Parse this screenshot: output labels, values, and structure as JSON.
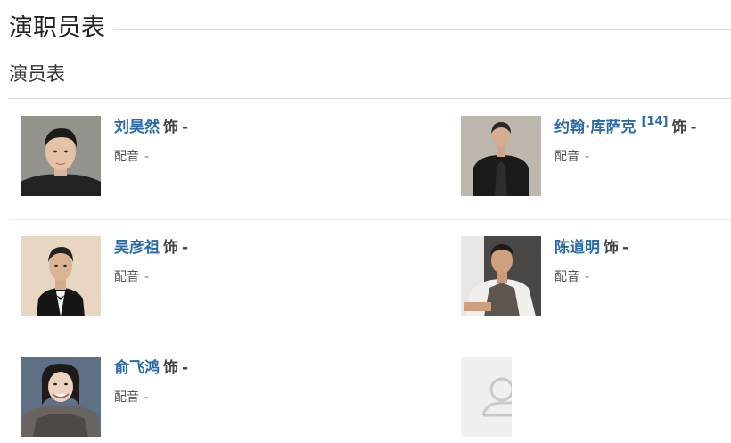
{
  "section": {
    "title": "演职员表"
  },
  "subsection": {
    "title": "演员表"
  },
  "cast": [
    {
      "name": "刘昊然",
      "ref": "",
      "as_label": "饰",
      "role": "-",
      "voice_label": "配音",
      "voice_value": "-",
      "photo": "portrait-photo"
    },
    {
      "name": "约翰·库萨克",
      "ref": "[14]",
      "as_label": "饰",
      "role": "-",
      "voice_label": "配音",
      "voice_value": "-",
      "photo": "portrait-photo"
    },
    {
      "name": "吴彦祖",
      "ref": "",
      "as_label": "饰",
      "role": "-",
      "voice_label": "配音",
      "voice_value": "-",
      "photo": "portrait-photo"
    },
    {
      "name": "陈道明",
      "ref": "",
      "as_label": "饰",
      "role": "-",
      "voice_label": "配音",
      "voice_value": "-",
      "photo": "portrait-photo"
    },
    {
      "name": "俞飞鸿",
      "ref": "",
      "as_label": "饰",
      "role": "-",
      "voice_label": "配音",
      "voice_value": "-",
      "photo": "portrait-photo"
    },
    {
      "name": "",
      "ref": "",
      "as_label": "",
      "role": "",
      "voice_label": "",
      "voice_value": "",
      "photo": "avatar-placeholder-icon"
    }
  ]
}
